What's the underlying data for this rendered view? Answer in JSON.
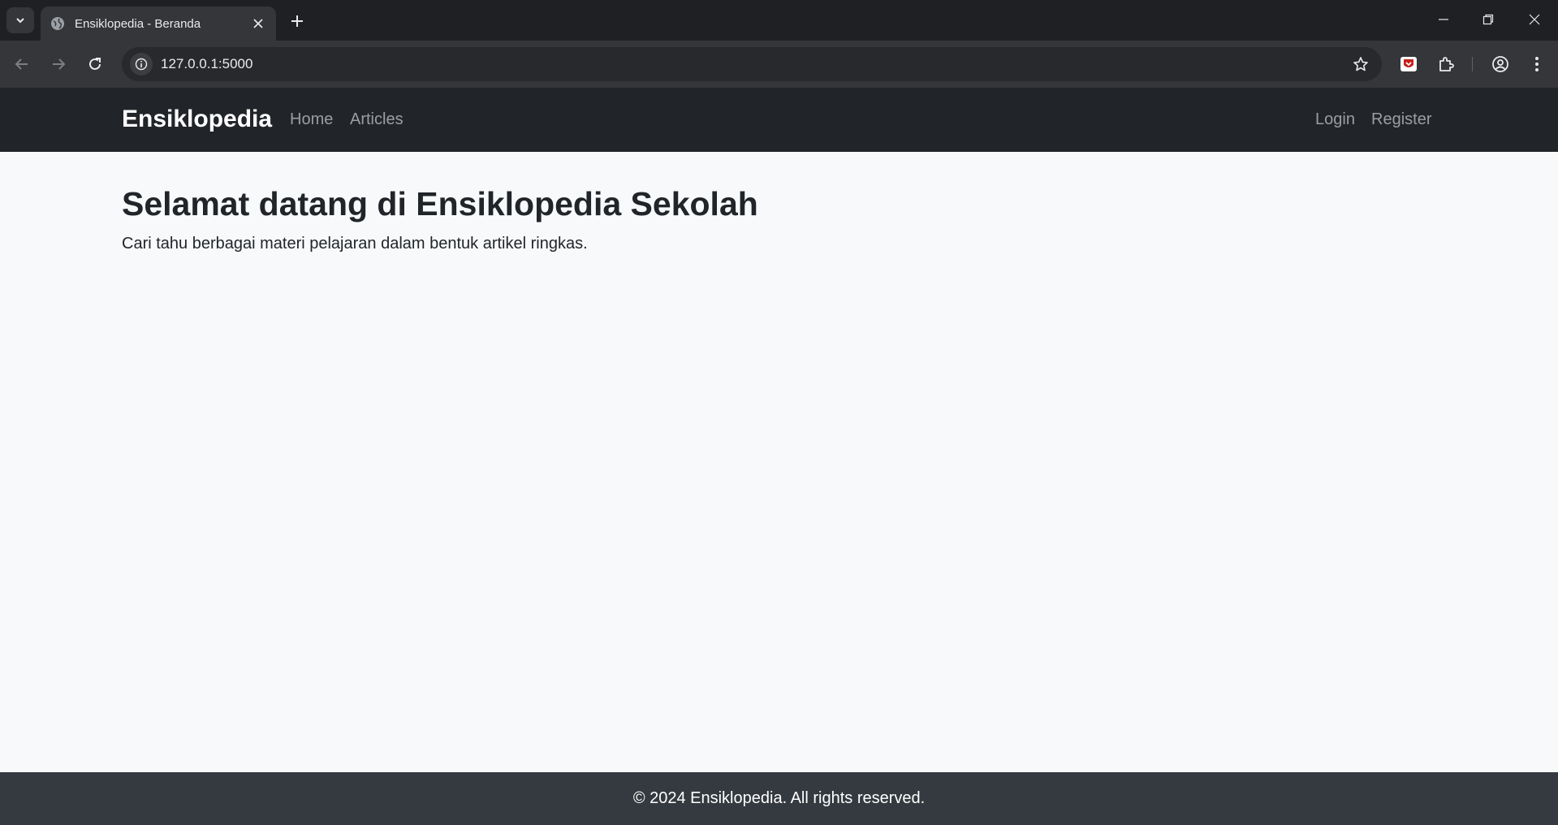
{
  "browser": {
    "tab_title": "Ensiklopedia - Beranda",
    "url": "127.0.0.1:5000"
  },
  "navbar": {
    "brand": "Ensiklopedia",
    "links": [
      {
        "label": "Home"
      },
      {
        "label": "Articles"
      }
    ],
    "auth": [
      {
        "label": "Login"
      },
      {
        "label": "Register"
      }
    ]
  },
  "hero": {
    "title": "Selamat datang di Ensiklopedia Sekolah",
    "subtitle": "Cari tahu berbagai materi pelajaran dalam bentuk artikel ringkas."
  },
  "footer": {
    "text": "© 2024 Ensiklopedia. All rights reserved."
  },
  "colors": {
    "navbar_bg": "#212529",
    "page_bg": "#f8f9fa",
    "footer_bg": "#343a40"
  },
  "icons": [
    "tab-search-icon",
    "globe-icon",
    "close-icon",
    "plus-icon",
    "minimize-icon",
    "restore-icon",
    "window-close-icon",
    "back-icon",
    "forward-icon",
    "reload-icon",
    "info-icon",
    "star-icon",
    "extension-shield-icon",
    "puzzle-icon",
    "profile-icon",
    "more-icon"
  ]
}
